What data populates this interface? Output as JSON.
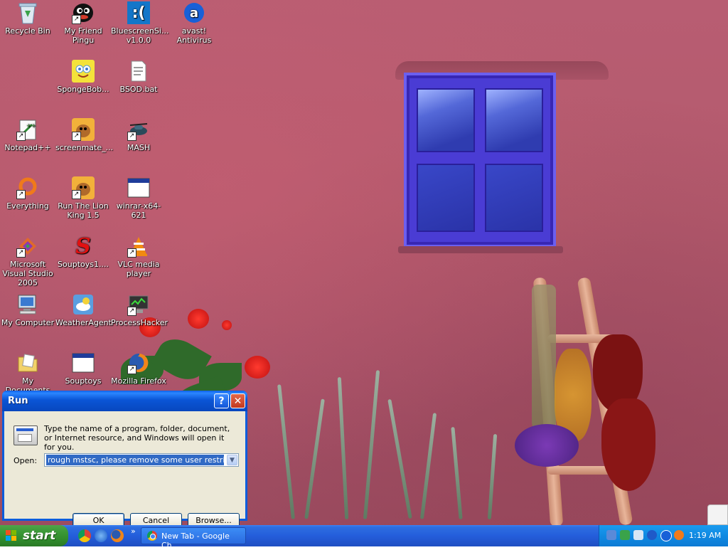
{
  "desktop": {
    "icons": [
      {
        "label": "Recycle Bin",
        "icon": "recycle-bin-icon"
      },
      {
        "label": "My Friend Pingu",
        "icon": "pingu-icon"
      },
      {
        "label": "BluescreenSi... v1.0.0",
        "icon": "bluescreen-icon"
      },
      {
        "label": "avast! Antivirus",
        "icon": "avast-icon"
      },
      {
        "label": "SpongeBob...",
        "icon": "spongebob-icon"
      },
      {
        "label": "BSOD.bat",
        "icon": "batch-file-icon"
      },
      {
        "label": "Notepad++",
        "icon": "notepad-plus-plus-icon"
      },
      {
        "label": "screenmate_...",
        "icon": "screenmate-icon"
      },
      {
        "label": "MASH",
        "icon": "mash-icon"
      },
      {
        "label": "Everything",
        "icon": "everything-search-icon"
      },
      {
        "label": "Run The Lion King 1.5",
        "icon": "lion-king-icon"
      },
      {
        "label": "winrar-x64-621",
        "icon": "application-window-icon"
      },
      {
        "label": "Microsoft Visual Studio 2005",
        "icon": "visual-studio-icon"
      },
      {
        "label": "Souptoys1....",
        "icon": "souptoys-icon"
      },
      {
        "label": "VLC media player",
        "icon": "vlc-icon"
      },
      {
        "label": "My Computer",
        "icon": "my-computer-icon"
      },
      {
        "label": "WeatherAgent",
        "icon": "weather-agent-icon"
      },
      {
        "label": "ProcessHacker",
        "icon": "process-hacker-icon"
      },
      {
        "label": "My Documents",
        "icon": "my-documents-icon"
      },
      {
        "label": "Souptoys",
        "icon": "souptoys-window-icon"
      },
      {
        "label": "Mozilla Firefox",
        "icon": "firefox-icon"
      }
    ]
  },
  "run_dialog": {
    "title": "Run",
    "help_glyph": "?",
    "close_glyph": "✕",
    "description": "Type the name of a program, folder, document, or Internet resource, and Windows will open it for you.",
    "open_label": "Open:",
    "open_value": "rough mstsc, please remove some user restrictions",
    "ok_label": "OK",
    "cancel_label": "Cancel",
    "browse_label": "Browse..."
  },
  "taskbar": {
    "start_label": "start",
    "quick_launch_overflow": "»",
    "tasks": [
      {
        "label": "New Tab - Google Ch...",
        "icon": "chrome-icon"
      }
    ],
    "clock": "1:19 AM"
  },
  "colors": {
    "taskbar_blue": "#245edb",
    "start_green": "#3c9a38",
    "title_blue": "#0a55d6",
    "dialog_face": "#ece9d8",
    "selection_blue": "#316ac5"
  }
}
